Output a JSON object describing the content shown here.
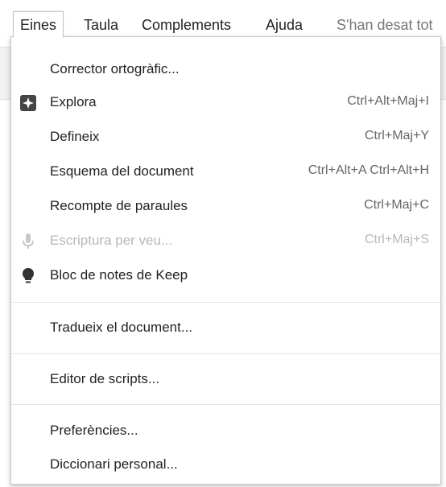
{
  "menubar": {
    "items": [
      {
        "label": "Eines"
      },
      {
        "label": "Taula"
      },
      {
        "label": "Complements"
      },
      {
        "label": "Ajuda"
      }
    ],
    "status": "S'han desat tot"
  },
  "menu": {
    "items": [
      {
        "label": "Corrector ortogràfic...",
        "shortcut": "",
        "icon": "",
        "enabled": true
      },
      {
        "label": "Explora",
        "shortcut": "Ctrl+Alt+Maj+I",
        "icon": "explore-icon",
        "enabled": true
      },
      {
        "label": "Defineix",
        "shortcut": "Ctrl+Maj+Y",
        "icon": "",
        "enabled": true
      },
      {
        "label": "Esquema del document",
        "shortcut": "Ctrl+Alt+A Ctrl+Alt+H",
        "icon": "",
        "enabled": true
      },
      {
        "label": "Recompte de paraules",
        "shortcut": "Ctrl+Maj+C",
        "icon": "",
        "enabled": true
      },
      {
        "label": "Escriptura per veu...",
        "shortcut": "Ctrl+Maj+S",
        "icon": "microphone-icon",
        "enabled": false
      },
      {
        "label": "Bloc de notes de Keep",
        "shortcut": "",
        "icon": "lightbulb-icon",
        "enabled": true
      },
      {
        "label": "Tradueix el document...",
        "shortcut": "",
        "icon": "",
        "enabled": true
      },
      {
        "label": "Editor de scripts...",
        "shortcut": "",
        "icon": "",
        "enabled": true
      },
      {
        "label": "Preferències...",
        "shortcut": "",
        "icon": "",
        "enabled": true
      },
      {
        "label": "Diccionari personal...",
        "shortcut": "",
        "icon": "",
        "enabled": true
      }
    ]
  },
  "colors": {
    "text": "#222222",
    "disabled": "#b8b8b8",
    "shortcut": "#666666",
    "icon": "#444444"
  }
}
